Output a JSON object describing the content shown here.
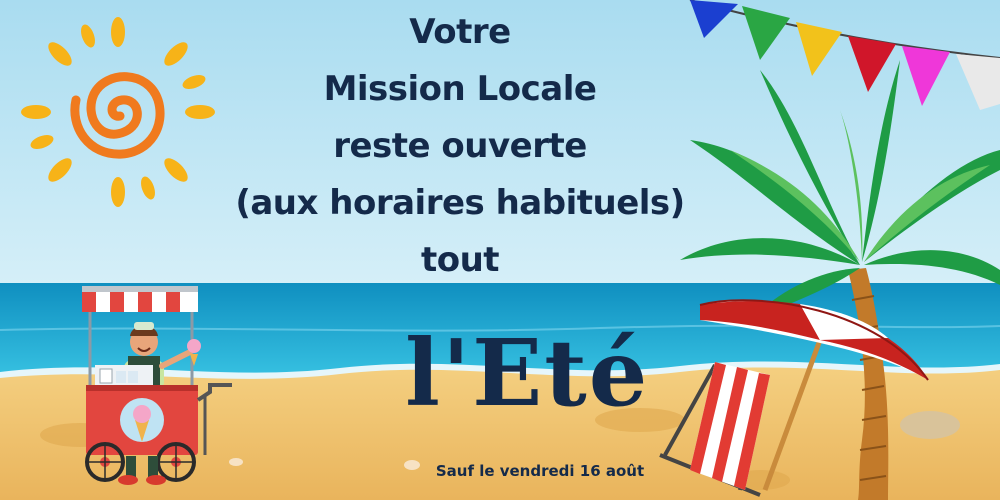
{
  "headline": {
    "line1": "Votre",
    "line2": "Mission Locale",
    "line3": "reste ouverte",
    "line4": "(aux horaires habituels)",
    "line5": "tout"
  },
  "big_word": "l'Eté",
  "footnote": "Sauf le vendredi 16 août",
  "colors": {
    "sky": "#bfe6f5",
    "sea": "#1aa7cf",
    "sand": "#f2c46d",
    "text": "#142a4a",
    "sun": "#f7b318",
    "sun_swirl": "#f07a1e",
    "cart_red": "#e2463f",
    "umbrella_red": "#c8231f"
  },
  "icons": {
    "sun": "sun-icon",
    "flags": "bunting-flags",
    "palm": "palm-tree",
    "umbrella": "beach-umbrella",
    "chair": "deck-chair",
    "cart": "ice-cream-cart",
    "vendor": "ice-cream-vendor"
  }
}
